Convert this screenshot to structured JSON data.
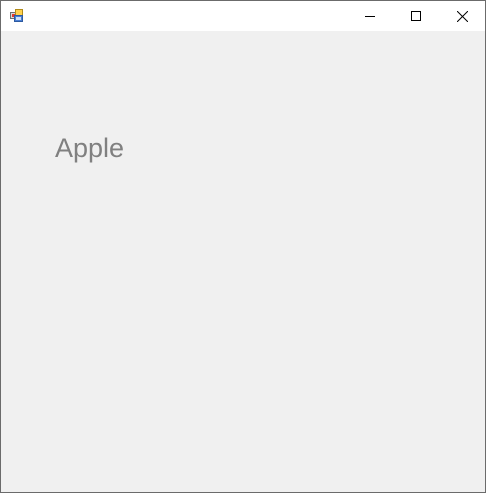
{
  "window": {
    "title": "",
    "icon": "winforms-app-icon"
  },
  "titlebar": {
    "buttons": [
      {
        "name": "minimize",
        "icon": "minimize-icon"
      },
      {
        "name": "maximize",
        "icon": "maximize-icon"
      },
      {
        "name": "close",
        "icon": "close-icon"
      }
    ]
  },
  "content": {
    "label": "Apple"
  },
  "colors": {
    "titlebar_bg": "#ffffff",
    "client_bg": "#f0f0f0",
    "label_text": "#808080",
    "border": "#6b6b6b"
  }
}
